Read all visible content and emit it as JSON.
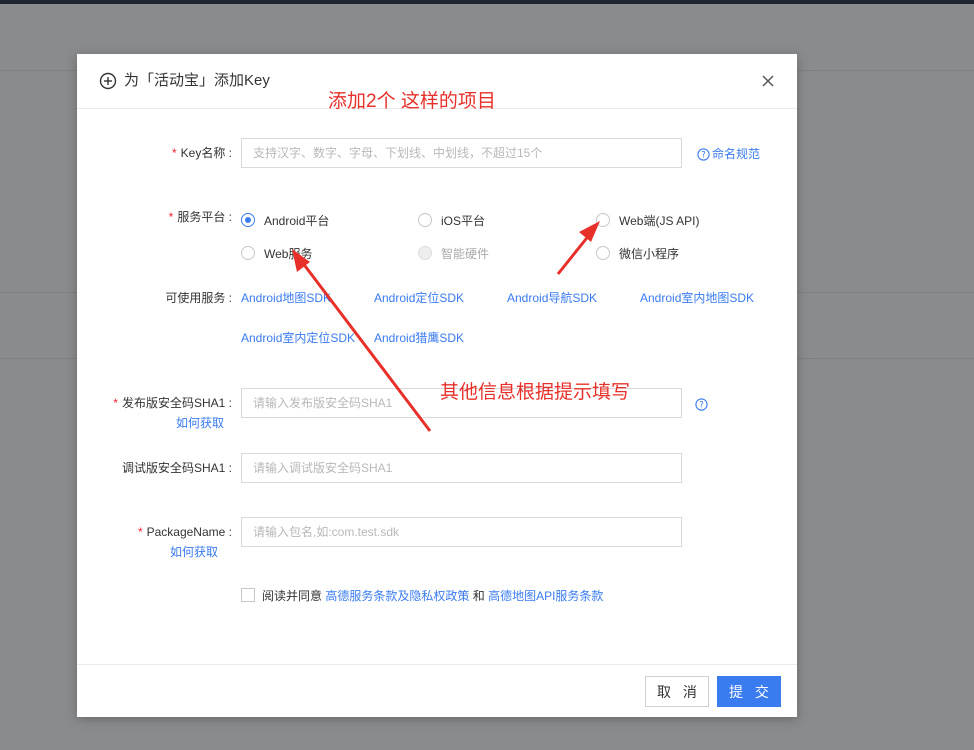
{
  "dialog": {
    "title": "为「活动宝」添加Key",
    "key_name": {
      "label": "Key名称",
      "placeholder": "支持汉字、数字、字母、下划线、中划线，不超过15个",
      "rule_link": "命名规范"
    },
    "platform": {
      "label": "服务平台",
      "options": [
        {
          "label": "Android平台",
          "state": "checked"
        },
        {
          "label": "iOS平台",
          "state": "unchecked"
        },
        {
          "label": "Web端(JS API)",
          "state": "unchecked"
        },
        {
          "label": "Web服务",
          "state": "unchecked"
        },
        {
          "label": "智能硬件",
          "state": "disabled"
        },
        {
          "label": "微信小程序",
          "state": "unchecked"
        }
      ]
    },
    "services": {
      "label": "可使用服务",
      "items": [
        "Android地图SDK",
        "Android定位SDK",
        "Android导航SDK",
        "Android室内地图SDK",
        "Android室内定位SDK",
        "Android猎鹰SDK"
      ]
    },
    "release_sha1": {
      "label": "发布版安全码SHA1",
      "placeholder": "请输入发布版安全码SHA1",
      "how_link": "如何获取"
    },
    "debug_sha1": {
      "label": "调试版安全码SHA1",
      "placeholder": "请输入调试版安全码SHA1"
    },
    "package_name": {
      "label": "PackageName",
      "placeholder": "请输入包名,如:com.test.sdk",
      "how_link": "如何获取"
    },
    "agreement": {
      "prefix": "阅读并同意",
      "link1": "高德服务条款及隐私权政策",
      "conj": "和",
      "link2": "高德地图API服务条款"
    },
    "buttons": {
      "cancel": "取 消",
      "submit": "提 交"
    }
  },
  "annotations": {
    "top_note": "添加2个 这样的项目",
    "mid_note": "其他信息根据提示填写",
    "color": "#e8302a"
  },
  "colors": {
    "accent": "#3a7bf0",
    "required": "#f5222d"
  }
}
